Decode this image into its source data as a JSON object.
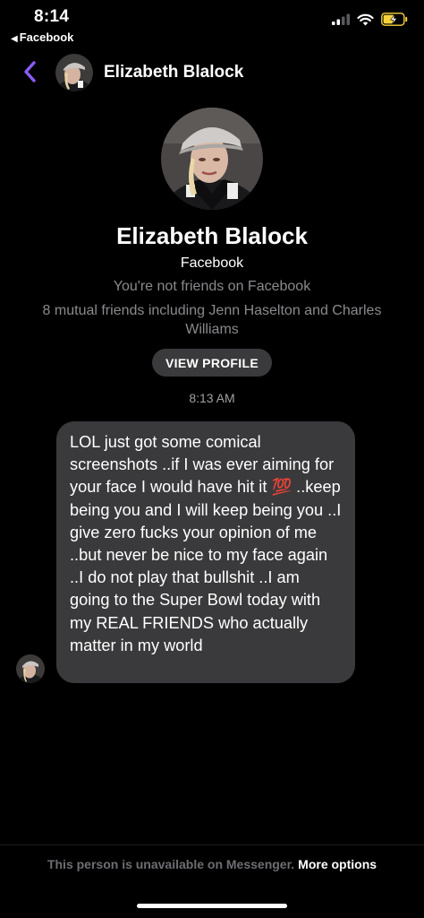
{
  "status_bar": {
    "time": "8:14",
    "back_app": "Facebook",
    "icons": [
      "cellular-signal-icon",
      "wifi-icon",
      "battery-charging-icon"
    ],
    "battery_color": "#f7d23c"
  },
  "header": {
    "contact_name": "Elizabeth Blalock",
    "back_icon": "chevron-left-icon",
    "accent_color": "#8b5cf6"
  },
  "profile": {
    "name": "Elizabeth Blalock",
    "source": "Facebook",
    "friend_status": "You're not friends on Facebook",
    "mutual_friends": "8 mutual friends including Jenn Haselton and Charles Williams",
    "view_profile_label": "VIEW PROFILE"
  },
  "conversation": {
    "timestamp": "8:13 AM",
    "messages": [
      {
        "text": "LOL just got some comical screenshots ..if I was ever aiming for your face I would have hit it 💯 ..keep being you and I will keep being you ..I give zero fucks your opinion of me ..but never be nice to my face again  ..I do not play that bullshit ..I am going to the Super Bowl today with my REAL FRIENDS who actually matter in my world"
      }
    ]
  },
  "footer": {
    "note": "This person is unavailable on Messenger.",
    "more_options": "More options"
  }
}
